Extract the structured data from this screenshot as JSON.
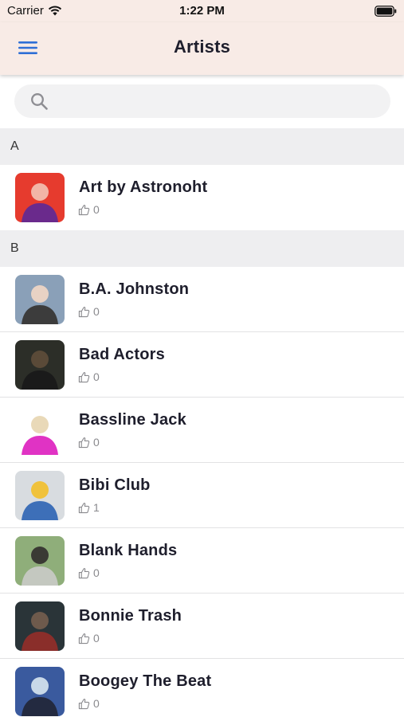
{
  "status_bar": {
    "carrier": "Carrier",
    "time": "1:22 PM"
  },
  "nav": {
    "title": "Artists",
    "menu_icon": "hamburger-menu-icon"
  },
  "search": {
    "placeholder": ""
  },
  "colors": {
    "accent": "#2f6fd6",
    "nav_background": "#f8ebe6",
    "section_background": "#eeeef0"
  },
  "sections": [
    {
      "letter": "A",
      "artists": [
        {
          "name": "Art by Astronoht",
          "likes": "0",
          "avatar_colors": [
            "#e63b2e",
            "#f2b5a6",
            "#6a2a8c"
          ]
        }
      ]
    },
    {
      "letter": "B",
      "artists": [
        {
          "name": "B.A. Johnston",
          "likes": "0",
          "avatar_colors": [
            "#8aa0b8",
            "#e8d2c4",
            "#3c3c3c"
          ]
        },
        {
          "name": "Bad Actors",
          "likes": "0",
          "avatar_colors": [
            "#2c2e28",
            "#5a4a38",
            "#1a1a1a"
          ]
        },
        {
          "name": "Bassline Jack",
          "likes": "0",
          "avatar_colors": [
            "#ffffff",
            "#e9d9b8",
            "#e033c4"
          ]
        },
        {
          "name": "Bibi Club",
          "likes": "1",
          "avatar_colors": [
            "#d8dce0",
            "#f0c23c",
            "#3d6fb8"
          ]
        },
        {
          "name": "Blank Hands",
          "likes": "0",
          "avatar_colors": [
            "#8fae7a",
            "#3a3a34",
            "#c4c8c0"
          ]
        },
        {
          "name": "Bonnie Trash",
          "likes": "0",
          "avatar_colors": [
            "#2a3438",
            "#6e5a4c",
            "#8a2e2a"
          ]
        },
        {
          "name": "Boogey The Beat",
          "likes": "0",
          "avatar_colors": [
            "#3a5a9e",
            "#c8d8e8",
            "#232a40"
          ]
        }
      ]
    }
  ]
}
